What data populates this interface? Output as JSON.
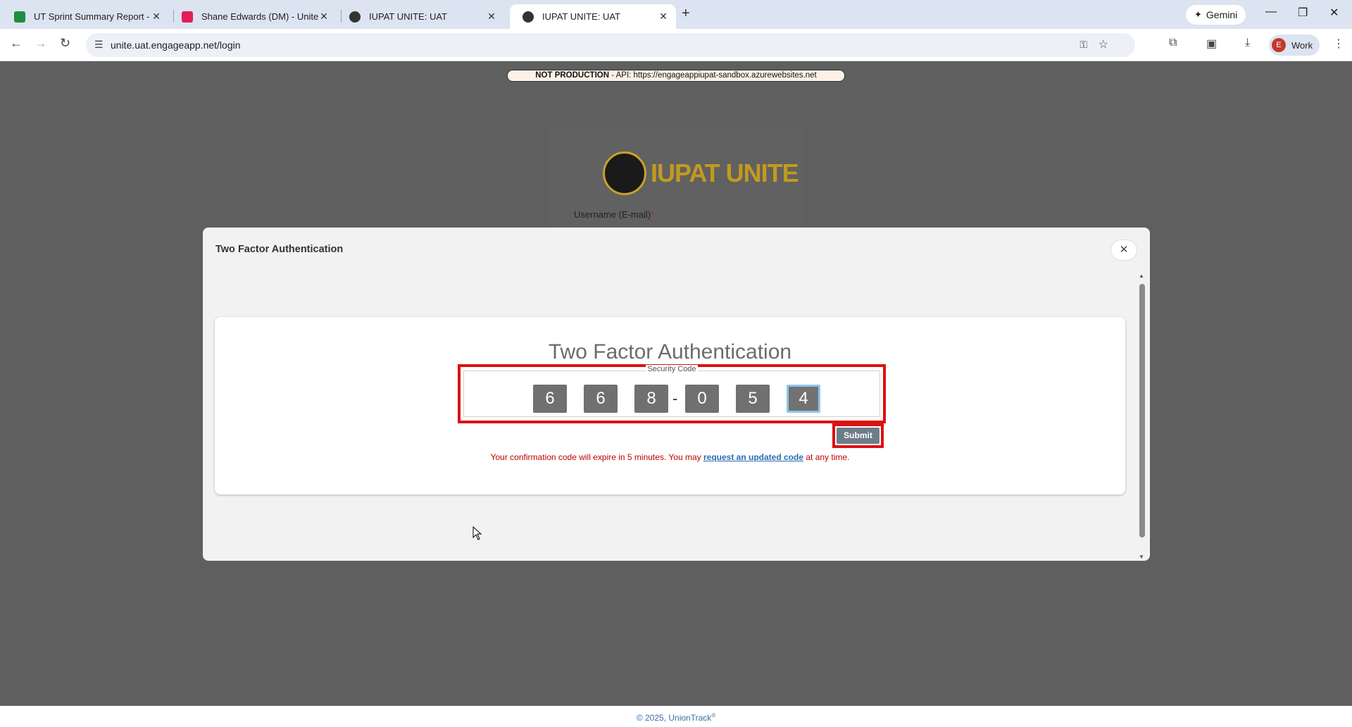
{
  "browser": {
    "tabs": [
      {
        "title": "UT Sprint Summary Report - Go",
        "favicon_color": "#1e8e3e",
        "active": false
      },
      {
        "title": "Shane Edwards (DM) - Unite - S",
        "favicon_color": "#e01e5a",
        "active": false
      },
      {
        "title": "IUPAT UNITE: UAT",
        "favicon_color": "#333333",
        "active": false
      },
      {
        "title": "IUPAT UNITE: UAT",
        "favicon_color": "#333333",
        "active": true
      }
    ],
    "gemini_label": "Gemini",
    "url": "unite.uat.engageapp.net/login",
    "profile_initial": "E",
    "profile_label": "Work"
  },
  "page": {
    "banner_bold": "NOT PRODUCTION",
    "banner_rest": " - API: https://engageappiupat-sandbox.azurewebsites.net",
    "logo_text": "IUPAT UNITE",
    "username_label": "Username (E-mail)",
    "required_mark": "*",
    "footer_text": "© 2025, UnionTrack",
    "footer_sup": "®"
  },
  "modal": {
    "title": "Two Factor Authentication",
    "close_symbol": "✕",
    "heading": "Two Factor Authentication",
    "security_code_label": "Security Code",
    "digits": [
      "6",
      "6",
      "8",
      "0",
      "5",
      "4"
    ],
    "separator": "-",
    "submit_label": "Submit",
    "expire_text_before": "Your confirmation code will expire in 5 minutes. You may ",
    "expire_link": "request an updated code",
    "expire_text_after": " at any time."
  },
  "colors": {
    "highlight_border": "#dd1111",
    "submit_bg": "#6e7b88",
    "digit_bg": "#707070",
    "logo_gold": "#c39a1f"
  }
}
